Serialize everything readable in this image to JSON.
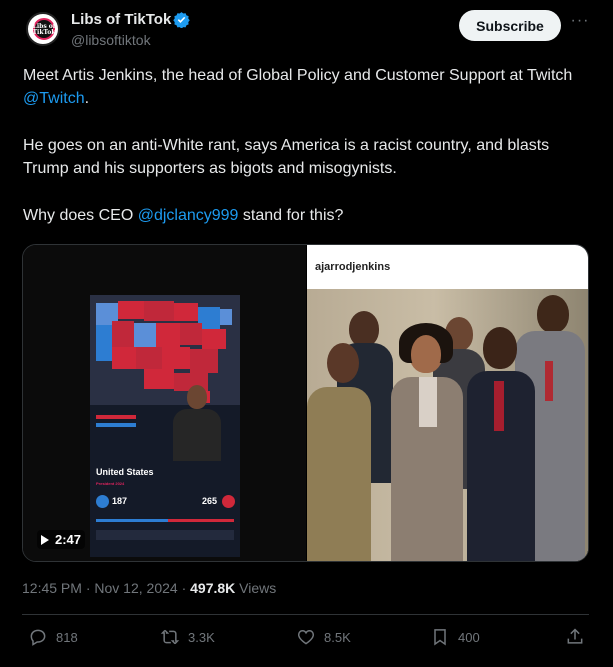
{
  "author": {
    "display_name": "Libs of TikTok",
    "handle": "@libsoftiktok",
    "avatar_text": "Libs of TikTok",
    "verified_color": "#1d9bf0"
  },
  "subscribe_label": "Subscribe",
  "more_label": "···",
  "tweet": {
    "p1_before": "Meet Artis Jenkins, the head of Global Policy and Customer Support at Twitch ",
    "p1_mention": "@Twitch",
    "p1_after": ".",
    "p2": "He goes on an anti-White rant, says America is a racist country, and blasts Trump and his supporters as bigots and misogynists.",
    "p3_before": "Why does CEO ",
    "p3_mention": "@djclancy999",
    "p3_after": " stand for this?"
  },
  "media": {
    "video": {
      "duration": "2:47",
      "screen_country": "United States",
      "screen_subtitle": "President 2024",
      "harris_votes": "187",
      "trump_votes": "265"
    },
    "photo": {
      "username": "ajarrodjenkins"
    }
  },
  "meta": {
    "time": "12:45 PM",
    "separator": " · ",
    "date": "Nov 12, 2024",
    "views_count": "497.8K",
    "views_label": " Views"
  },
  "actions": {
    "replies": "818",
    "reposts": "3.3K",
    "likes": "8.5K",
    "bookmarks": "400"
  },
  "colors": {
    "background": "#000000",
    "link": "#1d9bf0",
    "muted": "#71767b",
    "text": "#e7e9ea"
  }
}
